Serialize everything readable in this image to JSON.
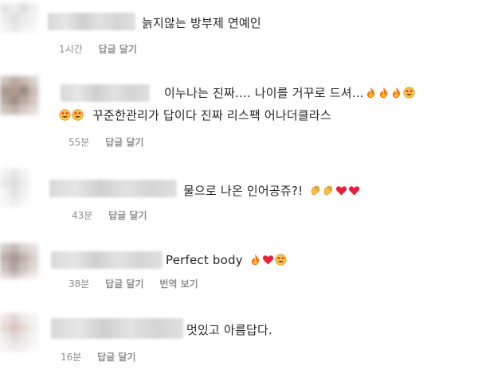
{
  "comments": [
    {
      "text": "늙지않는 방부제 연예인",
      "emojis": [],
      "time": "1시간",
      "reply": "답글 달기",
      "translate": ""
    },
    {
      "text": "이누나는 진짜.... 나이를 거꾸로 드셔...",
      "emojis": [
        "fire-emoji",
        "fire-emoji",
        "fire-emoji",
        "heart-eyes-emoji"
      ],
      "text2_emojis": [
        "heart-eyes-emoji",
        "heart-eyes-emoji"
      ],
      "text2": "꾸준한관리가 답이다 진짜 리스팩 어나더클라스",
      "time": "55분",
      "reply": "답글 달기",
      "translate": ""
    },
    {
      "text": "물으로 나온 인어공쥬?!",
      "emojis": [
        "clap-emoji",
        "clap-emoji",
        "heart-emoji",
        "heart-emoji"
      ],
      "time": "43분",
      "reply": "답글 달기",
      "translate": ""
    },
    {
      "text": "Perfect body",
      "emojis": [
        "fire-emoji",
        "heart-emoji",
        "heart-eyes-emoji"
      ],
      "time": "38분",
      "reply": "답글 달기",
      "translate": "번역 보기"
    },
    {
      "text": "멋있고 아름답다.",
      "emojis": [],
      "time": "16분",
      "reply": "답글 달기",
      "translate": ""
    }
  ],
  "colors": {
    "text": "#262626",
    "meta": "#8e8e8e",
    "heart": "#ed1c3c",
    "fire": "#f57a12",
    "clap": "#f7c245"
  }
}
